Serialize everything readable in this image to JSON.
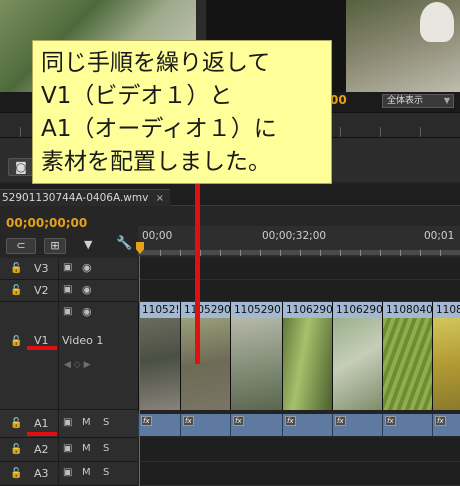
{
  "callout": {
    "lines": [
      "同じ手順を繰り返して",
      "V1（ビデオ１）と",
      "A1（オーディオ１）に",
      "素材を配置しました。"
    ]
  },
  "preview": {
    "timecode_partial": "00",
    "zoom_select": "全体表示"
  },
  "sequence": {
    "tab_label": "52901130744A-0406A.wmv",
    "close_label": "×",
    "timecode": "00;00;00;00"
  },
  "ruler": {
    "labels": [
      "00;00",
      "00;00;32;00",
      "00;01"
    ]
  },
  "tracks": {
    "v3": {
      "label": "V3"
    },
    "v2": {
      "label": "V2"
    },
    "v1": {
      "label": "V1",
      "name": "Video 1"
    },
    "a1": {
      "label": "A1",
      "mute": "M",
      "solo": "S"
    },
    "a2": {
      "label": "A2",
      "mute": "M",
      "solo": "S"
    },
    "a3": {
      "label": "A3",
      "mute": "M",
      "solo": "S"
    }
  },
  "clips": {
    "video": [
      "11052!",
      "1105290",
      "1105290",
      "1106290",
      "1106290",
      "1108040",
      "1108"
    ],
    "fx_label": "fx"
  },
  "icons": {
    "lock": "lock-icon",
    "film": "film-sync-icon",
    "eye": "eye-icon",
    "camera": "camera-icon",
    "wrench": "wrench-icon",
    "marker": "marker-icon"
  },
  "colors": {
    "callout_bg": "#ffff99",
    "highlight_red": "#e01010",
    "timecode": "#e3a21a",
    "clip_header": "#a3b8d3",
    "audio_clip": "#5e7aa0"
  }
}
